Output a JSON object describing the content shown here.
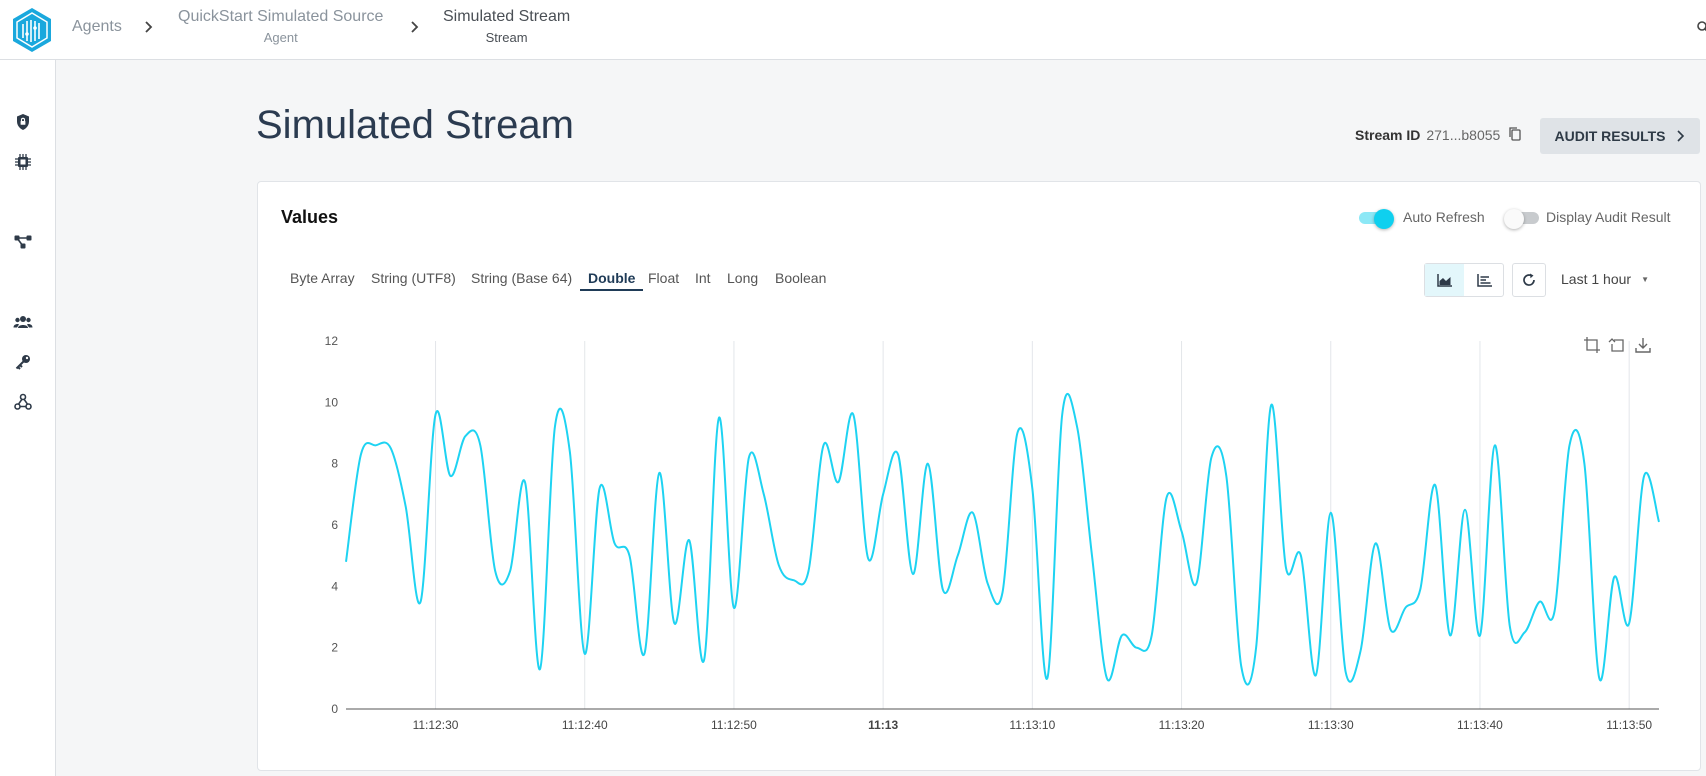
{
  "breadcrumb": {
    "items": [
      {
        "label": "Agents"
      },
      {
        "label": "QuickStart Simulated Source",
        "sublabel": "Agent"
      },
      {
        "label": "Simulated Stream",
        "sublabel": "Stream"
      }
    ]
  },
  "sidebar": {
    "icons": [
      "shield-lock-icon",
      "chip-icon",
      "share-nodes-icon",
      "users-icon",
      "key-icon",
      "webhook-icon"
    ]
  },
  "page": {
    "title": "Simulated Stream",
    "stream_id_label": "Stream ID",
    "stream_id_value": "271...b8055",
    "audit_button": "AUDIT RESULTS"
  },
  "card": {
    "title": "Values",
    "auto_refresh": {
      "label": "Auto Refresh",
      "on": true
    },
    "display_audit": {
      "label": "Display Audit Result",
      "on": false
    },
    "data_tabs": [
      "Byte Array",
      "String (UTF8)",
      "String (Base 64)",
      "Double",
      "Float",
      "Int",
      "Long",
      "Boolean"
    ],
    "active_tab": "Double",
    "time_range": "Last 1 hour"
  },
  "colors": {
    "accent": "#1ed3f2",
    "title": "#2b3b50",
    "toggle_on": "#0fd0ef",
    "toggle_track_on": "#8ce8f6"
  },
  "chart_data": {
    "type": "line",
    "title": "",
    "xlabel": "",
    "ylabel": "",
    "ylim": [
      0,
      12
    ],
    "yticks": [
      "0",
      "2",
      "4",
      "6",
      "8",
      "10",
      "12"
    ],
    "xticks": [
      "11:12:30",
      "11:12:40",
      "11:12:50",
      "11:13",
      "11:13:10",
      "11:13:20",
      "11:13:30",
      "11:13:40",
      "11:13:50"
    ],
    "x_range_seconds": [
      -6.0,
      82.0
    ],
    "grid": "vertical",
    "series": [
      {
        "color": "#1ed3f2",
        "points": [
          [
            -6.0,
            4.8
          ],
          [
            -5.0,
            8.3
          ],
          [
            -4.0,
            8.6
          ],
          [
            -3.0,
            8.5
          ],
          [
            -2.0,
            6.6
          ],
          [
            -1.0,
            3.5
          ],
          [
            0.0,
            9.6
          ],
          [
            1.0,
            7.6
          ],
          [
            2.0,
            8.9
          ],
          [
            3.0,
            8.6
          ],
          [
            4.0,
            4.5
          ],
          [
            5.0,
            4.5
          ],
          [
            6.0,
            7.4
          ],
          [
            7.0,
            1.3
          ],
          [
            8.0,
            9.2
          ],
          [
            9.0,
            8.4
          ],
          [
            10.0,
            1.8
          ],
          [
            11.0,
            7.2
          ],
          [
            12.0,
            5.4
          ],
          [
            13.0,
            5.0
          ],
          [
            14.0,
            1.8
          ],
          [
            15.0,
            7.7
          ],
          [
            16.0,
            2.8
          ],
          [
            17.0,
            5.5
          ],
          [
            18.0,
            1.6
          ],
          [
            19.0,
            9.5
          ],
          [
            20.0,
            3.3
          ],
          [
            21.0,
            8.2
          ],
          [
            22.0,
            7.0
          ],
          [
            23.0,
            4.7
          ],
          [
            24.0,
            4.2
          ],
          [
            25.0,
            4.5
          ],
          [
            26.0,
            8.6
          ],
          [
            27.0,
            7.4
          ],
          [
            28.0,
            9.6
          ],
          [
            29.0,
            4.9
          ],
          [
            30.0,
            7.0
          ],
          [
            31.0,
            8.3
          ],
          [
            32.0,
            4.4
          ],
          [
            33.0,
            8.0
          ],
          [
            34.0,
            3.9
          ],
          [
            35.0,
            5.0
          ],
          [
            36.0,
            6.4
          ],
          [
            37.0,
            4.1
          ],
          [
            38.0,
            3.8
          ],
          [
            39.0,
            9.0
          ],
          [
            40.0,
            7.2
          ],
          [
            41.0,
            1.0
          ],
          [
            42.0,
            9.6
          ],
          [
            43.0,
            9.2
          ],
          [
            44.0,
            5.0
          ],
          [
            45.0,
            1.0
          ],
          [
            46.0,
            2.4
          ],
          [
            47.0,
            2.0
          ],
          [
            48.0,
            2.4
          ],
          [
            49.0,
            6.9
          ],
          [
            50.0,
            5.8
          ],
          [
            51.0,
            4.1
          ],
          [
            52.0,
            8.2
          ],
          [
            53.0,
            7.6
          ],
          [
            54.0,
            1.4
          ],
          [
            55.0,
            2.0
          ],
          [
            56.0,
            9.9
          ],
          [
            57.0,
            4.6
          ],
          [
            58.0,
            5.0
          ],
          [
            59.0,
            1.1
          ],
          [
            60.0,
            6.4
          ],
          [
            61.0,
            1.2
          ],
          [
            62.0,
            1.9
          ],
          [
            63.0,
            5.4
          ],
          [
            64.0,
            2.6
          ],
          [
            65.0,
            3.3
          ],
          [
            66.0,
            3.9
          ],
          [
            67.0,
            7.3
          ],
          [
            68.0,
            2.4
          ],
          [
            69.0,
            6.5
          ],
          [
            70.0,
            2.4
          ],
          [
            71.0,
            8.6
          ],
          [
            72.0,
            2.7
          ],
          [
            73.0,
            2.5
          ],
          [
            74.0,
            3.5
          ],
          [
            75.0,
            3.2
          ],
          [
            76.0,
            8.6
          ],
          [
            77.0,
            8.0
          ],
          [
            78.0,
            1.0
          ],
          [
            79.0,
            4.3
          ],
          [
            80.0,
            2.8
          ],
          [
            81.0,
            7.6
          ],
          [
            82.0,
            6.1
          ]
        ]
      }
    ]
  }
}
